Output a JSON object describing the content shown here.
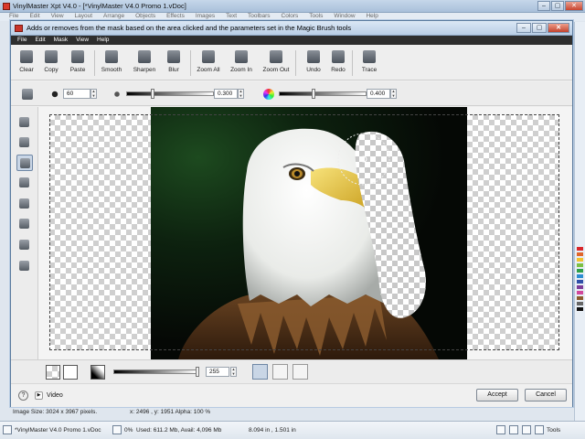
{
  "app": {
    "title": "VinylMaster Xpt V4.0 - [*VinylMaster V4.0 Promo 1.vDoc]",
    "menu": [
      "File",
      "Edit",
      "View",
      "Layout",
      "Arrange",
      "Objects",
      "Effects",
      "Images",
      "Text",
      "Toolbars",
      "Colors",
      "Tools",
      "Window",
      "Help"
    ],
    "window_controls": {
      "minimize": "–",
      "maximize": "▢",
      "close": "✕"
    },
    "palette_colors": [
      "#d9262a",
      "#e0662c",
      "#f2c22e",
      "#7cc043",
      "#2f9f48",
      "#2b8dd1",
      "#2f4fa8",
      "#7c3c98",
      "#d1479b",
      "#8c5a2b",
      "#666666",
      "#111111"
    ],
    "status": {
      "doc": "*VinylMaster V4.0 Promo 1.vDoc",
      "memory_percent": "0%",
      "memory": "Used: 611.2 Mb, Avail: 4,096 Mb",
      "dimensions": "8.094 in , 1.501 in",
      "tools_label": "Tools"
    }
  },
  "dialog": {
    "title": "Adds or removes from the mask based on the area clicked and the parameters set in the Magic Brush tools",
    "controls": {
      "minimize": "–",
      "maximize": "▢",
      "close": "✕"
    },
    "menu": [
      "File",
      "Edit",
      "Mask",
      "View",
      "Help"
    ],
    "toolbar": [
      "Clear",
      "Copy",
      "Paste",
      "Smooth",
      "Sharpen",
      "Blur",
      "Zoom All",
      "Zoom In",
      "Zoom Out",
      "Undo",
      "Redo",
      "Trace"
    ],
    "options": {
      "brush_size": "60",
      "tolerance": "0.300",
      "tolerance_level": 0.3,
      "color_tolerance": "0.400",
      "color_tolerance_level": 0.4
    },
    "left_tools": [
      "hand-tool",
      "zoom-tool",
      "fill-tool",
      "magic-brush-tool",
      "eraser-tool",
      "stamp-tool",
      "blob-tool",
      "gradient-tool",
      "pattern-tool"
    ],
    "active_left_tool": "magic-brush-tool",
    "bottom": {
      "alpha_value": "255",
      "alpha_level": 1.0
    },
    "footer": {
      "help": "?",
      "video_label": "Video",
      "accept": "Accept",
      "cancel": "Cancel"
    },
    "status": {
      "image_size": "Image Size: 3024 x 3967 pixels.",
      "coords": "x: 2496 , y: 1951  Alpha: 100 %"
    }
  }
}
